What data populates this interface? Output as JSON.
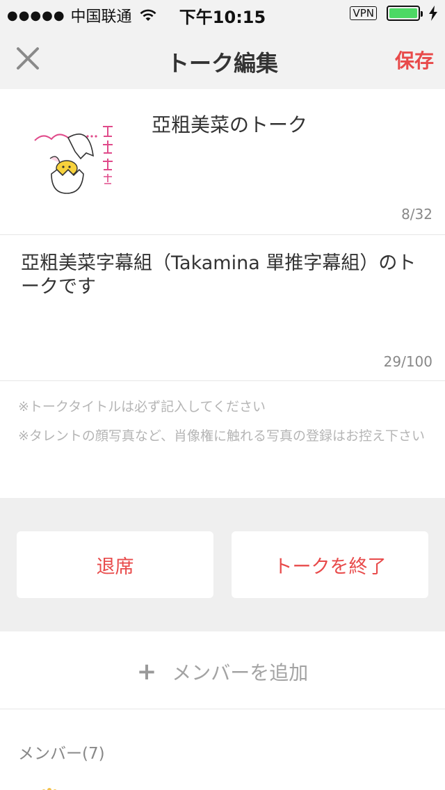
{
  "status_bar": {
    "signal": "●●●●●",
    "carrier": "中国联通",
    "time": "下午10:15",
    "vpn": "VPN",
    "battery_color": "#4cd964"
  },
  "nav": {
    "title": "トーク編集",
    "save_label": "保存",
    "close_icon": "close-icon",
    "accent_color": "#e84a4a"
  },
  "talk": {
    "name": "亞粗美菜のトーク",
    "name_count": "8/32",
    "thumbnail_alt": "亞粗美菜字幕",
    "description": "亞粗美菜字幕組（Takamina 單推字幕組）のトークです",
    "description_count": "29/100"
  },
  "notes": [
    "※トークタイトルは必ず記入してください",
    "※タレントの顔写真など、肖像権に触れる写真の登録はお控え下さい"
  ],
  "actions": {
    "leave_label": "退席",
    "end_label": "トークを終了"
  },
  "add_member": {
    "icon": "plus-icon",
    "label": "メンバーを追加"
  },
  "members": {
    "label": "メンバー(7)"
  }
}
